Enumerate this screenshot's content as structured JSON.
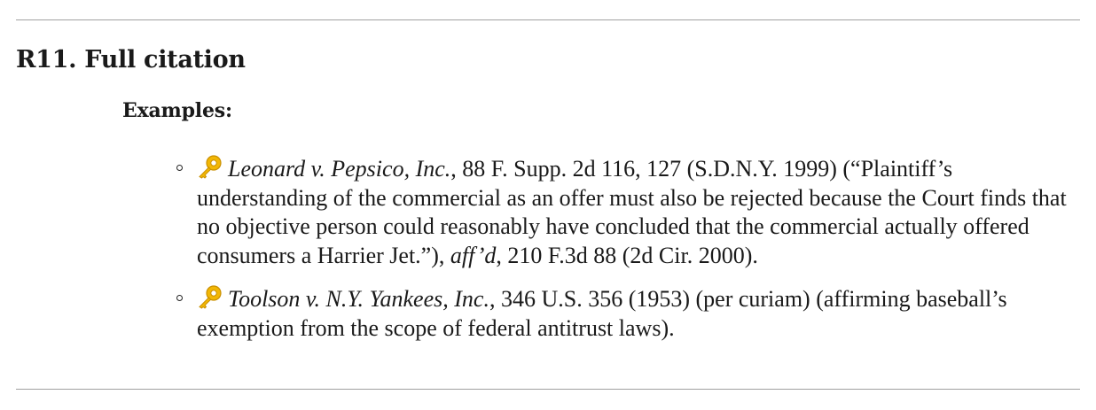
{
  "section": {
    "title": "R11. Full citation",
    "examples_label": "Examples:"
  },
  "icons": {
    "key_icon": "old-key-icon",
    "key_color": "#f2b705"
  },
  "examples": [
    {
      "case_name": "Leonard v. Pepsico, Inc.",
      "citation": ", 88 F. Supp. 2d 116, 127 (S.D.N.Y. 1999) (“Plaintiff’s understanding of the commercial as an offer must also be rejected because the Court finds that no objective person could reasonably have concluded that the commercial actually offered consumers a Harrier Jet.”), ",
      "history_signal": "aff’d",
      "history_citation": ", 210 F.3d 88 (2d Cir. 2000)."
    },
    {
      "case_name": "Toolson v. N.Y. Yankees, Inc.",
      "citation": ", 346 U.S. 356 (1953) (per curiam) (affirming baseball’s exemption from the scope of federal antitrust laws)."
    }
  ]
}
